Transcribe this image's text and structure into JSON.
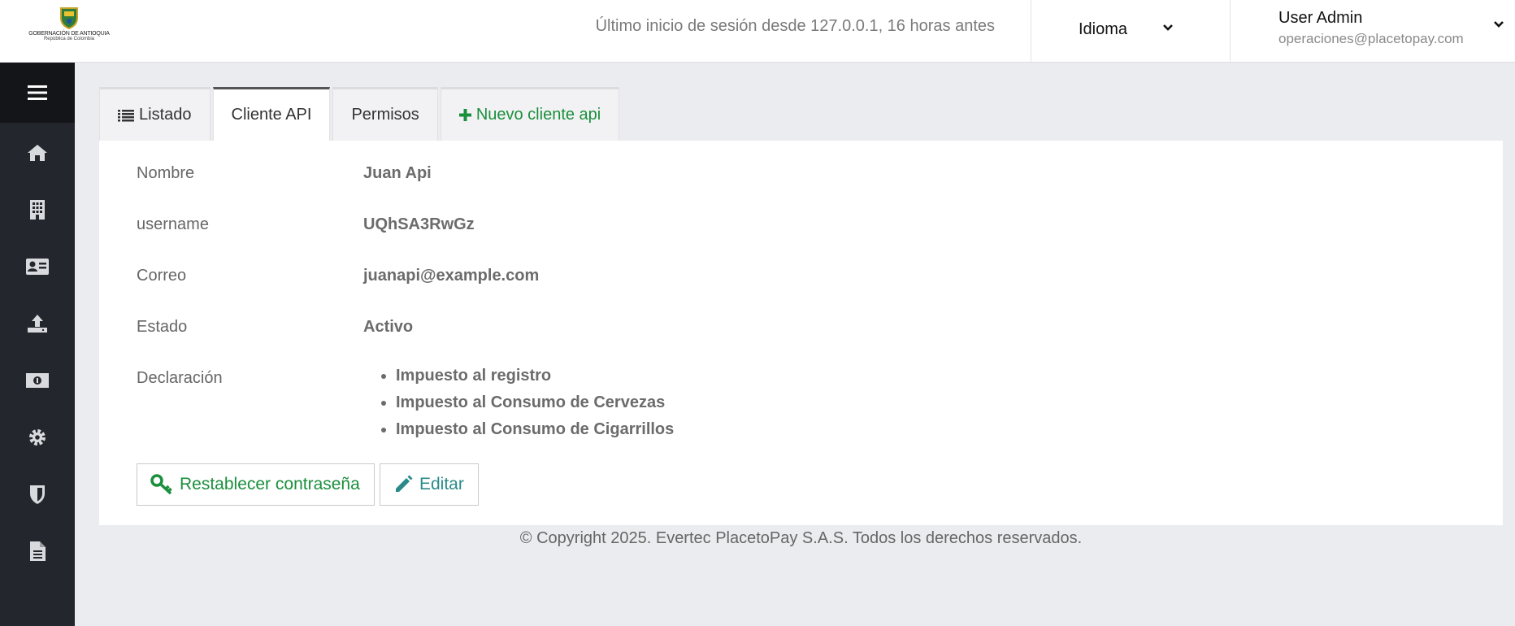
{
  "header": {
    "logo": {
      "line1": "GOBERNACIÓN DE ANTIOQUIA",
      "line2": "República de Colombia"
    },
    "last_login": "Último inicio de sesión desde 127.0.0.1, 16 horas antes",
    "language_label": "Idioma",
    "user": {
      "name": "User Admin",
      "email": "operaciones@placetopay.com"
    }
  },
  "sidebar": {
    "items": [
      {
        "icon": "home-icon"
      },
      {
        "icon": "building-icon"
      },
      {
        "icon": "id-card-icon"
      },
      {
        "icon": "upload-icon"
      },
      {
        "icon": "money-icon"
      },
      {
        "icon": "gear-icon"
      },
      {
        "icon": "shield-icon"
      },
      {
        "icon": "document-icon"
      }
    ]
  },
  "tabs": [
    {
      "label": "Listado",
      "icon": "list-icon"
    },
    {
      "label": "Cliente API",
      "active": true
    },
    {
      "label": "Permisos"
    },
    {
      "label": "Nuevo cliente api",
      "icon": "plus-icon",
      "color": "#1a8f3c"
    }
  ],
  "details": {
    "nombre": {
      "label": "Nombre",
      "value": "Juan Api"
    },
    "username": {
      "label": "username",
      "value": "UQhSA3RwGz"
    },
    "correo": {
      "label": "Correo",
      "value": "juanapi@example.com"
    },
    "estado": {
      "label": "Estado",
      "value": "Activo"
    },
    "declaracion": {
      "label": "Declaración",
      "items": [
        "Impuesto al registro",
        "Impuesto al Consumo de Cervezas",
        "Impuesto al Consumo de Cigarrillos"
      ]
    }
  },
  "actions": {
    "reset_password": "Restablecer contraseña",
    "edit": "Editar"
  },
  "footer": {
    "copyright": "© Copyright 2025. Evertec PlacetoPay S.A.S. Todos los derechos reservados."
  },
  "colors": {
    "accent_green": "#1a8f3c",
    "edit_teal": "#2a8a8a",
    "sidebar_bg": "#23272d",
    "page_bg": "#ebecef"
  }
}
